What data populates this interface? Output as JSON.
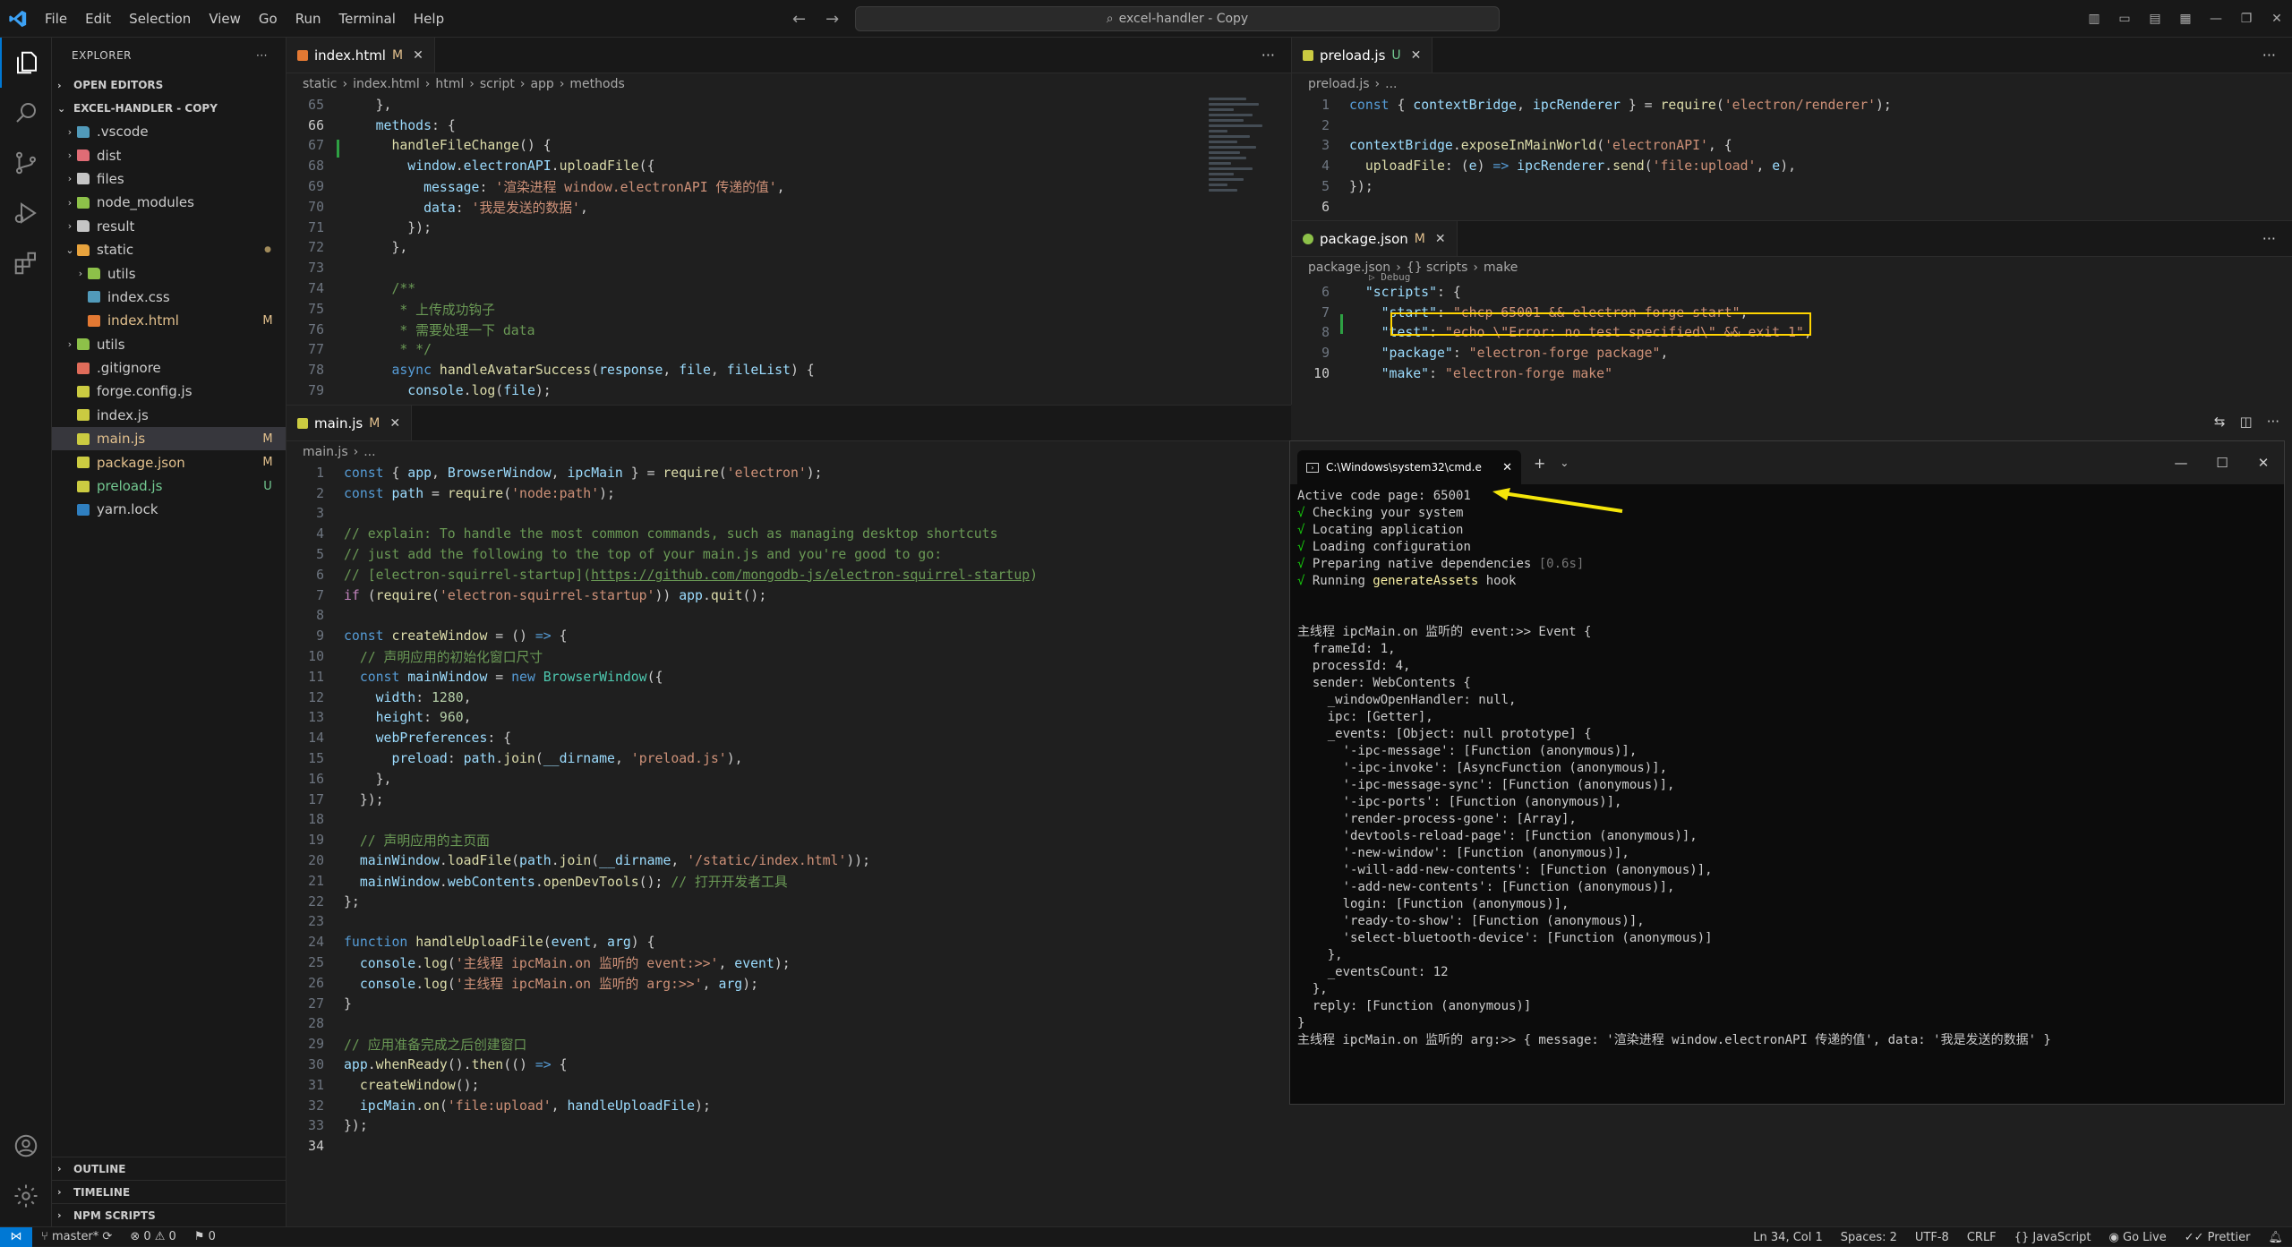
{
  "titlebar": {
    "menu": [
      "File",
      "Edit",
      "Selection",
      "View",
      "Go",
      "Run",
      "Terminal",
      "Help"
    ],
    "search_text": "excel-handler - Copy"
  },
  "explorer": {
    "header": "EXPLORER",
    "open_editors": "OPEN EDITORS",
    "project": "EXCEL-HANDLER - COPY",
    "items": [
      {
        "name": ".vscode",
        "type": "folder",
        "color": "#519aba",
        "badge": "",
        "depth": 0,
        "chev": "›"
      },
      {
        "name": "dist",
        "type": "folder",
        "color": "#e06c75",
        "badge": "",
        "depth": 0,
        "chev": "›"
      },
      {
        "name": "files",
        "type": "folder",
        "color": "#c5c5c5",
        "badge": "",
        "depth": 0,
        "chev": "›"
      },
      {
        "name": "node_modules",
        "type": "folder",
        "color": "#8dc149",
        "badge": "",
        "depth": 0,
        "chev": "›"
      },
      {
        "name": "result",
        "type": "folder",
        "color": "#c5c5c5",
        "badge": "",
        "depth": 0,
        "chev": "›"
      },
      {
        "name": "static",
        "type": "folder",
        "color": "#e8a33d",
        "badge": "●",
        "depth": 0,
        "chev": "⌄"
      },
      {
        "name": "utils",
        "type": "folder",
        "color": "#8dc149",
        "badge": "",
        "depth": 1,
        "chev": "›"
      },
      {
        "name": "index.css",
        "type": "file",
        "color": "#519aba",
        "badge": "",
        "depth": 1,
        "chev": ""
      },
      {
        "name": "index.html",
        "type": "file",
        "color": "#e37933",
        "badge": "M",
        "depth": 1,
        "chev": ""
      },
      {
        "name": "utils",
        "type": "folder",
        "color": "#8dc149",
        "badge": "",
        "depth": 0,
        "chev": "›"
      },
      {
        "name": ".gitignore",
        "type": "file",
        "color": "#e06c5a",
        "badge": "",
        "depth": 0,
        "chev": ""
      },
      {
        "name": "forge.config.js",
        "type": "file",
        "color": "#cbcb41",
        "badge": "",
        "depth": 0,
        "chev": ""
      },
      {
        "name": "index.js",
        "type": "file",
        "color": "#cbcb41",
        "badge": "",
        "depth": 0,
        "chev": ""
      },
      {
        "name": "main.js",
        "type": "file",
        "color": "#cbcb41",
        "badge": "M",
        "depth": 0,
        "chev": ""
      },
      {
        "name": "package.json",
        "type": "file",
        "color": "#cbcb41",
        "badge": "M",
        "depth": 0,
        "chev": ""
      },
      {
        "name": "preload.js",
        "type": "file",
        "color": "#cbcb41",
        "badge": "U",
        "depth": 0,
        "chev": ""
      },
      {
        "name": "yarn.lock",
        "type": "file",
        "color": "#2f7fc0",
        "badge": "",
        "depth": 0,
        "chev": ""
      }
    ],
    "bottom_sections": [
      "OUTLINE",
      "TIMELINE",
      "NPM SCRIPTS"
    ]
  },
  "editors": {
    "index_html": {
      "tab": "index.html",
      "status": "M",
      "breadcrumb": [
        "static",
        "index.html",
        "html",
        "script",
        "app",
        "methods"
      ]
    },
    "preload": {
      "tab": "preload.js",
      "status": "U",
      "breadcrumb": [
        "preload.js",
        "..."
      ]
    },
    "package_json": {
      "tab": "package.json",
      "status": "M",
      "breadcrumb": [
        "package.json",
        "{} scripts",
        "make"
      ],
      "codelens": "▷ Debug"
    },
    "main_js": {
      "tab": "main.js",
      "status": "M",
      "breadcrumb": [
        "main.js",
        "..."
      ]
    }
  },
  "terminal": {
    "tab_title": "C:\\Windows\\system32\\cmd.e",
    "lines": [
      {
        "text": "Active code page: 65001",
        "cls": ""
      },
      {
        "text": "√ Checking your system",
        "cls": "ok"
      },
      {
        "text": "√ Locating application",
        "cls": "ok"
      },
      {
        "text": "√ Loading configuration",
        "cls": "ok"
      },
      {
        "text": "√ Preparing native dependencies [0.6s]",
        "cls": "ok"
      },
      {
        "text": "√ Running generateAssets hook",
        "cls": "ok"
      },
      {
        "text": "",
        "cls": ""
      },
      {
        "text": "",
        "cls": ""
      },
      {
        "text": "主线程 ipcMain.on 监听的 event:>> Event {",
        "cls": ""
      },
      {
        "text": "  frameId: 1,",
        "cls": ""
      },
      {
        "text": "  processId: 4,",
        "cls": ""
      },
      {
        "text": "  sender: WebContents {",
        "cls": ""
      },
      {
        "text": "    _windowOpenHandler: null,",
        "cls": ""
      },
      {
        "text": "    ipc: [Getter],",
        "cls": ""
      },
      {
        "text": "    _events: [Object: null prototype] {",
        "cls": ""
      },
      {
        "text": "      '-ipc-message': [Function (anonymous)],",
        "cls": ""
      },
      {
        "text": "      '-ipc-invoke': [AsyncFunction (anonymous)],",
        "cls": ""
      },
      {
        "text": "      '-ipc-message-sync': [Function (anonymous)],",
        "cls": ""
      },
      {
        "text": "      '-ipc-ports': [Function (anonymous)],",
        "cls": ""
      },
      {
        "text": "      'render-process-gone': [Array],",
        "cls": ""
      },
      {
        "text": "      'devtools-reload-page': [Function (anonymous)],",
        "cls": ""
      },
      {
        "text": "      '-new-window': [Function (anonymous)],",
        "cls": ""
      },
      {
        "text": "      '-will-add-new-contents': [Function (anonymous)],",
        "cls": ""
      },
      {
        "text": "      '-add-new-contents': [Function (anonymous)],",
        "cls": ""
      },
      {
        "text": "      login: [Function (anonymous)],",
        "cls": ""
      },
      {
        "text": "      'ready-to-show': [Function (anonymous)],",
        "cls": ""
      },
      {
        "text": "      'select-bluetooth-device': [Function (anonymous)]",
        "cls": ""
      },
      {
        "text": "    },",
        "cls": ""
      },
      {
        "text": "    _eventsCount: 12",
        "cls": ""
      },
      {
        "text": "  },",
        "cls": ""
      },
      {
        "text": "  reply: [Function (anonymous)]",
        "cls": ""
      },
      {
        "text": "}",
        "cls": ""
      },
      {
        "text": "主线程 ipcMain.on 监听的 arg:>> { message: '渲染进程 window.electronAPI 传递的值', data: '我是发送的数据' }",
        "cls": ""
      }
    ]
  },
  "statusbar": {
    "branch": "master*",
    "errors": "0",
    "warnings": "0",
    "ports": "0",
    "position": "Ln 34, Col 1",
    "spaces": "Spaces: 2",
    "encoding": "UTF-8",
    "eol": "CRLF",
    "language": "JavaScript",
    "golive": "Go Live",
    "prettier": "Prettier"
  },
  "colors": {
    "accent": "#0078d4",
    "highlight_box": "#ffd400",
    "arrow": "#f5e60a"
  }
}
